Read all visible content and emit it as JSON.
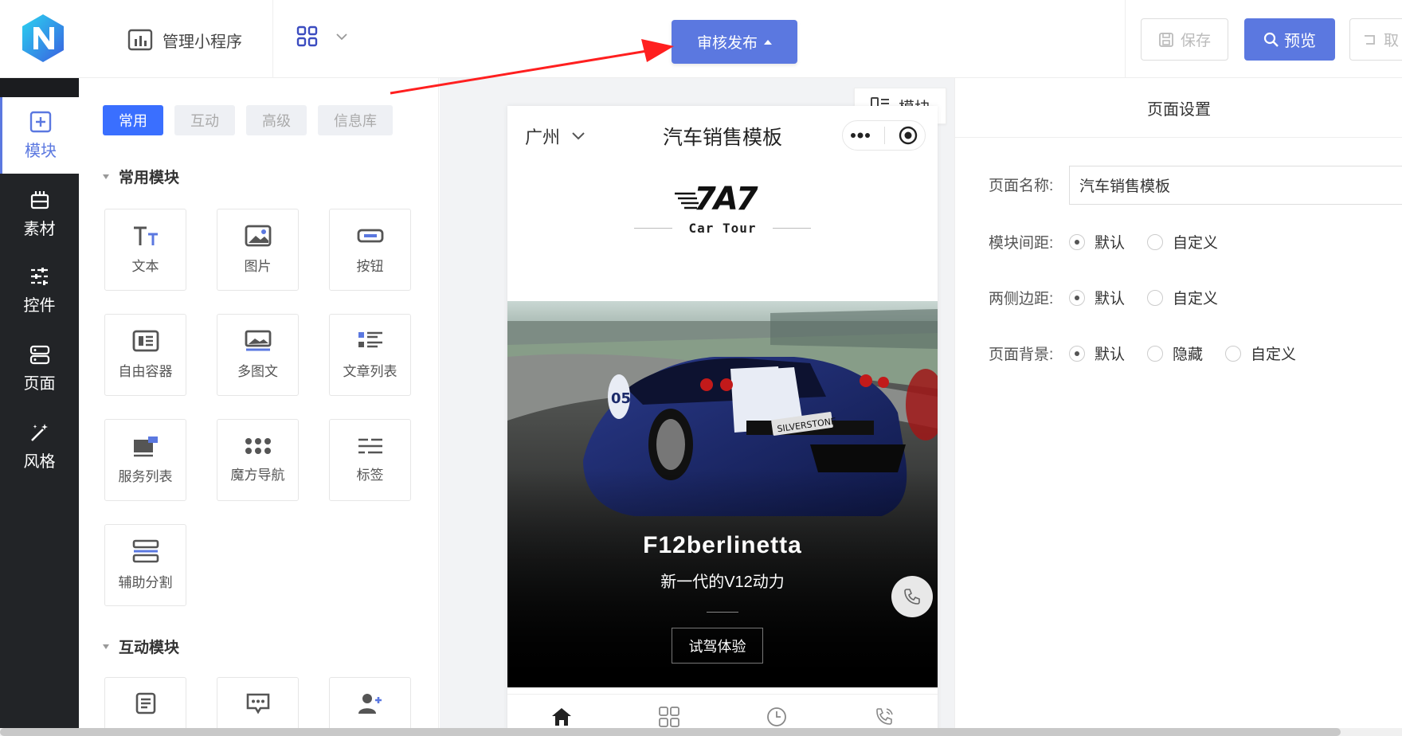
{
  "colors": {
    "accent": "#5b78e0",
    "nav_bg": "#222427",
    "tab_active": "#3a6fff",
    "arrow": "#ff1f1f"
  },
  "topbar": {
    "app_title": "管理小程序",
    "publish_label": "审核发布",
    "save_label": "保存",
    "preview_label": "预览",
    "cancel_label": "取"
  },
  "leftnav": {
    "items": [
      {
        "label": "模块",
        "icon": "plus-square-icon",
        "active": true
      },
      {
        "label": "素材",
        "icon": "material-icon"
      },
      {
        "label": "控件",
        "icon": "sliders-icon"
      },
      {
        "label": "页面",
        "icon": "page-icon"
      },
      {
        "label": "风格",
        "icon": "magic-wand-icon"
      }
    ]
  },
  "palette": {
    "tabs": [
      "常用",
      "互动",
      "高级",
      "信息库"
    ],
    "section_common": "常用模块",
    "section_interactive": "互动模块",
    "modules": [
      "文本",
      "图片",
      "按钮",
      "自由容器",
      "多图文",
      "文章列表",
      "服务列表",
      "魔方导航",
      "标签",
      "辅助分割"
    ]
  },
  "phone": {
    "city": "广州",
    "title": "汽车销售模板",
    "brand_mark": "7A7",
    "brand_sub": "Car Tour",
    "hero_title": "F12berlinetta",
    "hero_sub": "新一代的V12动力",
    "hero_button": "试驾体验",
    "plate_text": "SILVERSTONE",
    "car_number": "05"
  },
  "module_pill": "模块",
  "settings": {
    "title": "页面设置",
    "name_label": "页面名称:",
    "name_value": "汽车销售模板",
    "spacing_label": "模块间距:",
    "margin_label": "两侧边距:",
    "background_label": "页面背景:",
    "opt_default": "默认",
    "opt_custom": "自定义",
    "opt_hidden": "隐藏"
  }
}
